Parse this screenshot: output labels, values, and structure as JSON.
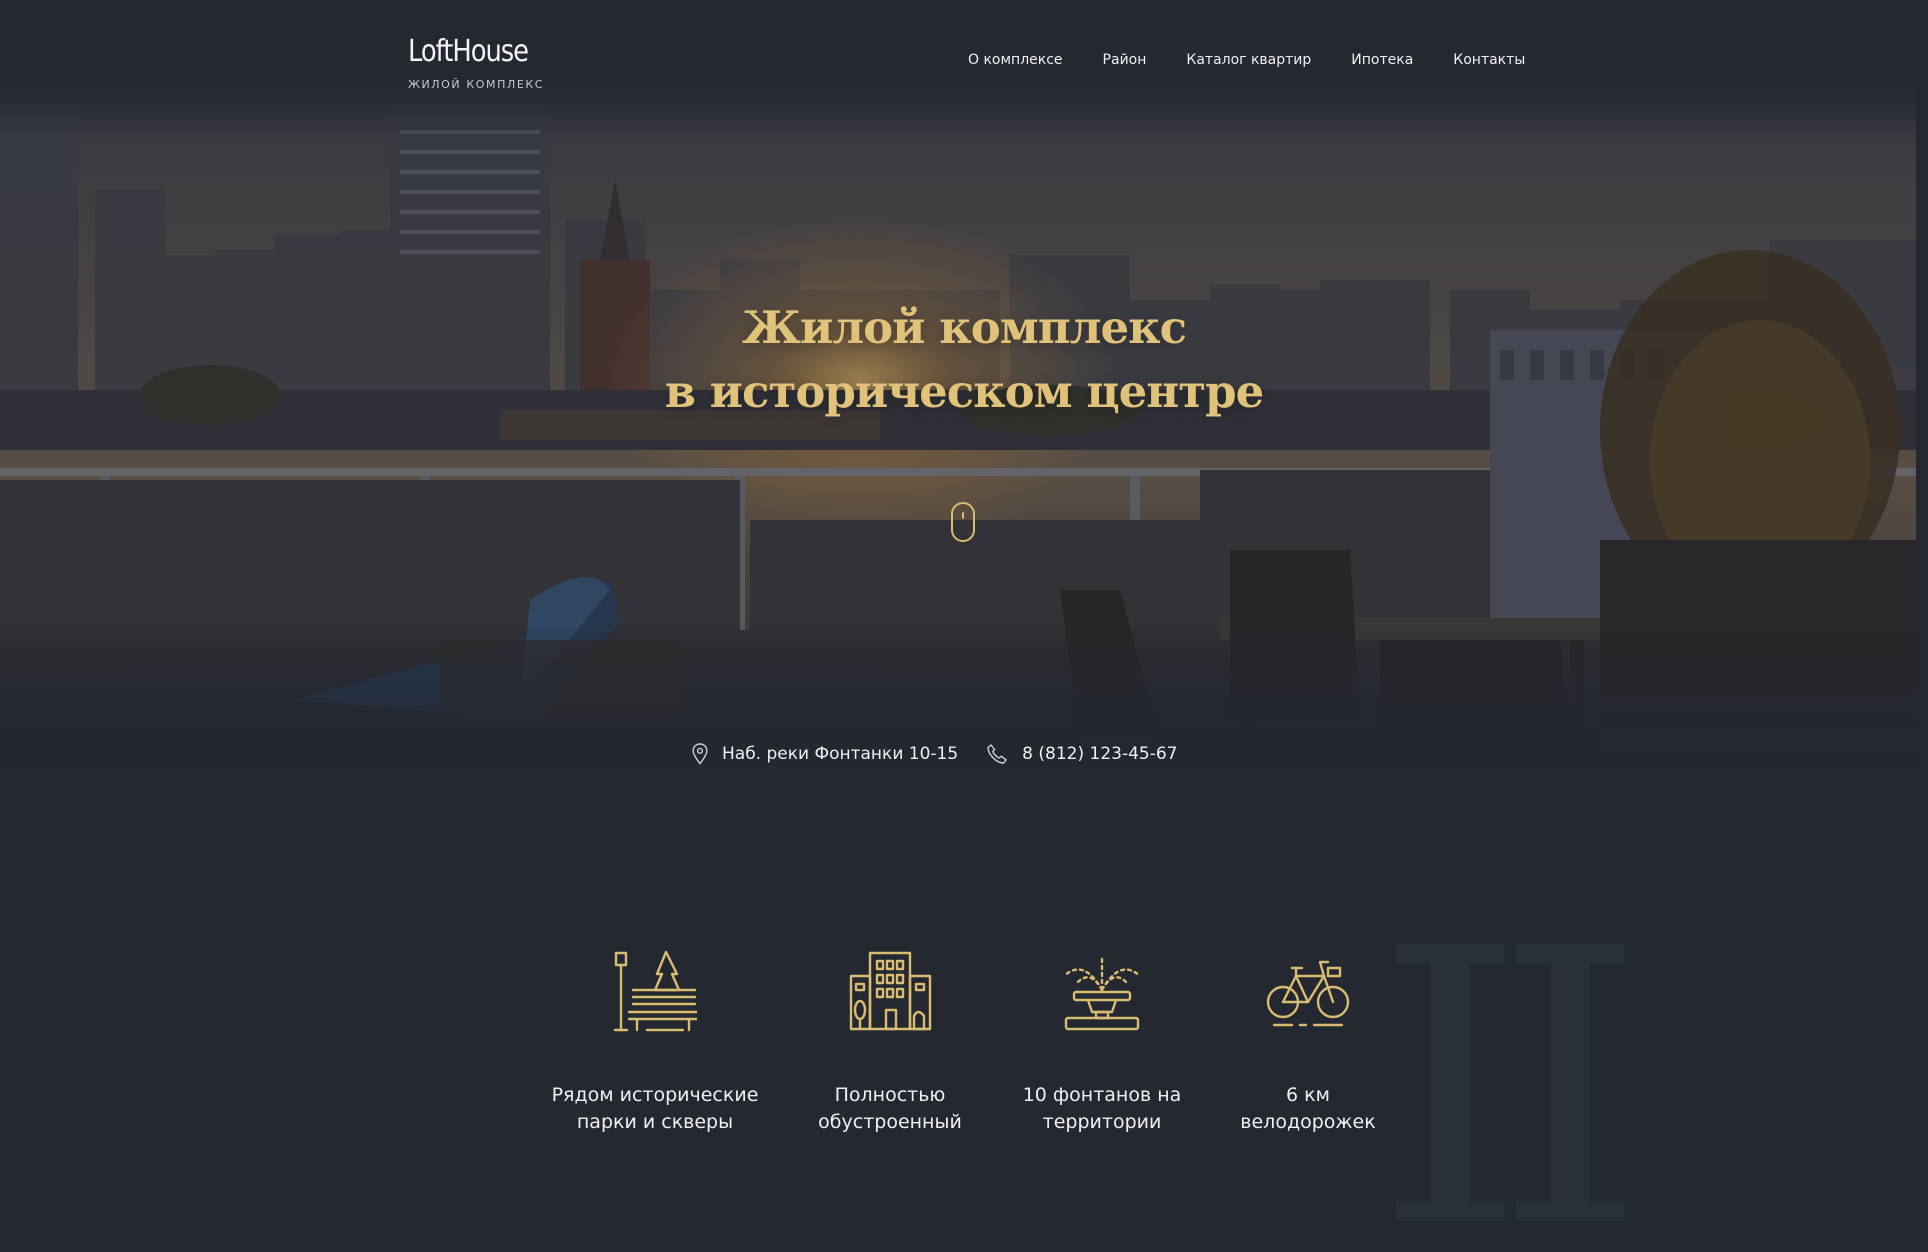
{
  "header": {
    "logo_title": "LoftHouse",
    "logo_subtitle": "ЖИЛОЙ КОМПЛЕКС",
    "nav": [
      {
        "label": "О комплексе"
      },
      {
        "label": "Район"
      },
      {
        "label": "Каталог квартир"
      },
      {
        "label": "Ипотека"
      },
      {
        "label": "Контакты"
      }
    ]
  },
  "hero": {
    "title_line1": "Жилой комплекс",
    "title_line2": "в историческом центре",
    "scroll_icon": "mouse-scroll-icon"
  },
  "contacts": {
    "address": "Наб. реки Фонтанки 10-15",
    "address_icon": "location-pin-icon",
    "phone": "8 (812) 123-45-67",
    "phone_icon": "phone-icon"
  },
  "features": [
    {
      "icon": "park-bench-icon",
      "text": "Рядом исторические\nпарки и скверы"
    },
    {
      "icon": "buildings-icon",
      "text": "Полностью\nобустроенный"
    },
    {
      "icon": "fountain-icon",
      "text": "10 фонтанов на\nтерритории"
    },
    {
      "icon": "bicycle-icon",
      "text": "6 км\nвелодорожек"
    }
  ],
  "colors": {
    "background": "#232831",
    "accent_gold": "#e0c27a",
    "text": "#f0f0f0"
  }
}
